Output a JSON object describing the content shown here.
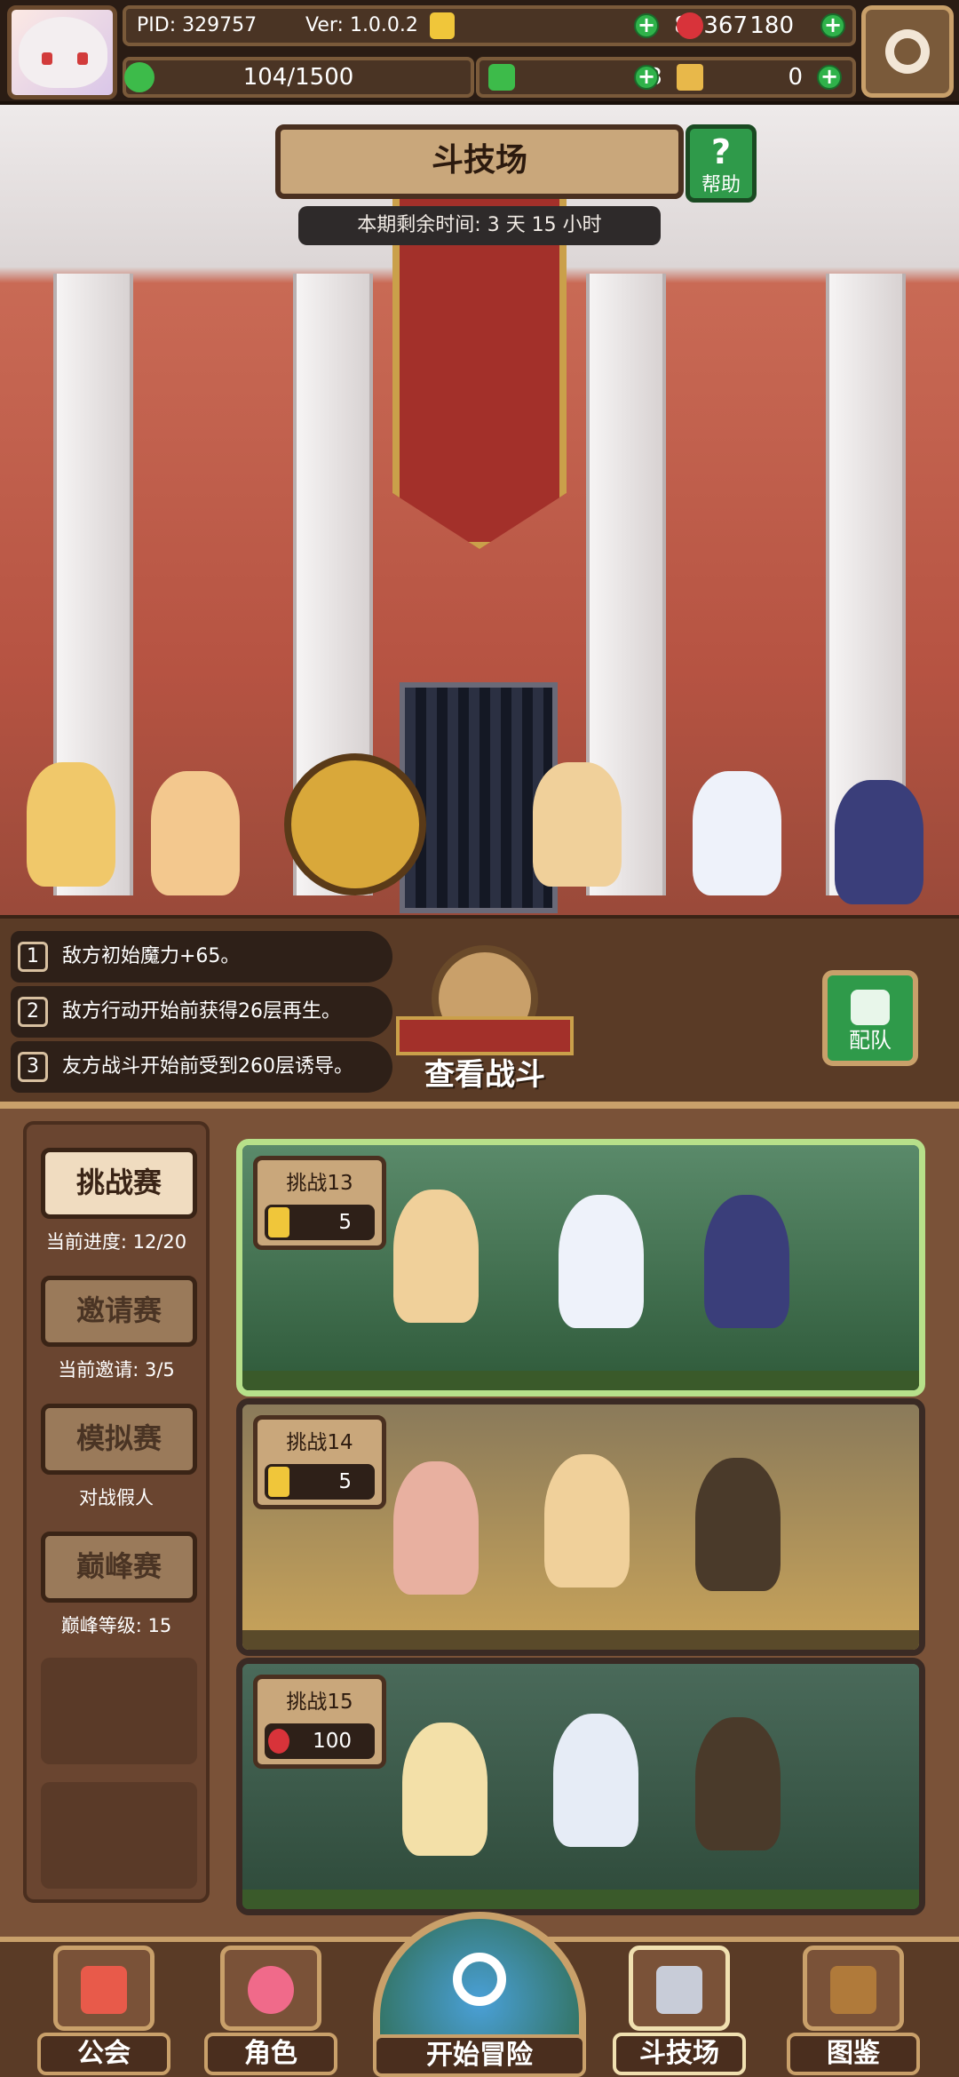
{
  "header": {
    "pid": "PID: 329757",
    "version": "Ver: 1.0.0.2",
    "gold": "80367",
    "red_gems": "180",
    "stamina": "104/1500",
    "clovers": "3",
    "keys": "0"
  },
  "arena": {
    "title": "斗技场",
    "help_label": "帮助",
    "help_icon": "?",
    "timer": "本期剩余时间: 3 天 15 小时"
  },
  "effects": {
    "items": [
      {
        "num": "1",
        "text": "敌方初始魔力+65。"
      },
      {
        "num": "2",
        "text": "敌方行动开始前获得26层再生。"
      },
      {
        "num": "3",
        "text": "友方战斗开始前受到260层诱导。"
      }
    ],
    "view_battle": "查看战斗",
    "team": "配队"
  },
  "modes": [
    {
      "label": "挑战赛",
      "sub": "当前进度: 12/20",
      "active": true
    },
    {
      "label": "邀请赛",
      "sub": "当前邀请: 3/5",
      "active": false
    },
    {
      "label": "模拟赛",
      "sub": "对战假人",
      "active": false
    },
    {
      "label": "巅峰赛",
      "sub": "巅峰等级: 15",
      "active": false
    }
  ],
  "challenges": [
    {
      "title": "挑战13",
      "cost": "5",
      "currency": "gold-gem-icon"
    },
    {
      "title": "挑战14",
      "cost": "5",
      "currency": "gold-gem-icon"
    },
    {
      "title": "挑战15",
      "cost": "100",
      "currency": "red-gem-icon"
    }
  ],
  "nav": {
    "guild": "公会",
    "character": "角色",
    "start": "开始冒险",
    "arena": "斗技场",
    "codex": "图鉴"
  },
  "colors": {
    "accent_gold": "#c9a06a",
    "selected_border": "#b7e08a",
    "green_button": "#2f9a4a",
    "wall_red": "#b65342"
  }
}
